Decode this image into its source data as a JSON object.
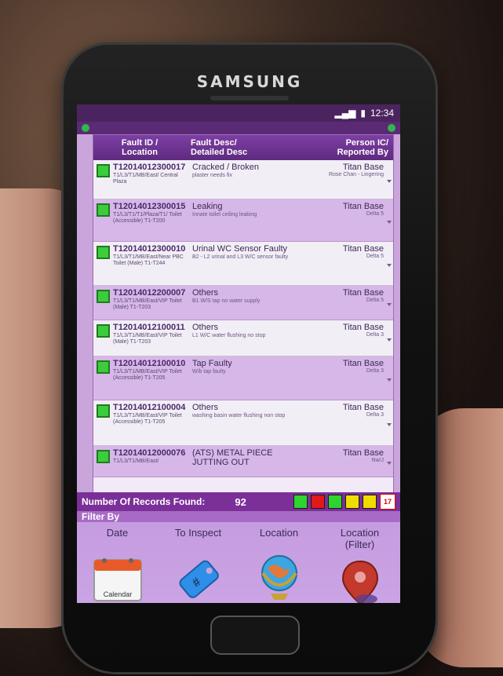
{
  "brand": "SAMSUNG",
  "status_time": "12:34",
  "table": {
    "headers": {
      "col1": [
        "Fault ID /",
        "Location"
      ],
      "col2": [
        "Fault Desc/",
        "Detailed Desc"
      ],
      "col3": [
        "Person IC/",
        "Reported By"
      ]
    },
    "rows": [
      {
        "id": "T12014012300017",
        "loc": "T1/L3/T1/MB/East/ Central Plaza",
        "desc": "Cracked / Broken",
        "detail": "plaster needs fix",
        "person": "Titan Base",
        "rep": "Rose Chan - Lingering"
      },
      {
        "id": "T12014012300015",
        "loc": "T1/L3/T1/T1/Plaza/T1/ Toilet (Accessible) T1-T200",
        "desc": "Leaking",
        "detail": "Innate toilet ceiling leaking",
        "person": "Titan Base",
        "rep": "Delta 5"
      },
      {
        "id": "T12014012300010",
        "loc": "T1/L3/T1/MB/East/Near PBC Toilet (Male) T1-T244",
        "desc": "Urinal WC Sensor Faulty",
        "detail": "B2 - L2 urinal and L3 W/C sensor faulty",
        "person": "Titan Base",
        "rep": "Delta 5"
      },
      {
        "id": "T12014012200007",
        "loc": "T1/L3/T1/MB/East/VIP Toilet (Male) T1-T203",
        "desc": "Others",
        "detail": "B1 W/S tap no water supply",
        "person": "Titan Base",
        "rep": "Delta 5"
      },
      {
        "id": "T12014012100011",
        "loc": "T1/L3/T1/MB/East/VIP Toilet (Male) T1-T203",
        "desc": "Others",
        "detail": "L1 W/C water flushing no stop",
        "person": "Titan Base",
        "rep": "Delta 3"
      },
      {
        "id": "T12014012100010",
        "loc": "T1/L3/T1/MB/East/VIP Toilet (Accessible) T1-T205",
        "desc": "Tap Faulty",
        "detail": "W/b tap faulty",
        "person": "Titan Base",
        "rep": "Delta 3"
      },
      {
        "id": "T12014012100004",
        "loc": "T1/L3/T1/MB/East/VIP Toilet (Accessible) T1-T205",
        "desc": "Others",
        "detail": "washing basin water flushing non stop",
        "person": "Titan Base",
        "rep": "Delta 3"
      },
      {
        "id": "T12014012000076",
        "loc": "T1/L3/T1/MB/East/",
        "desc": "(ATS) METAL PIECE JUTTING OUT",
        "detail": "",
        "person": "Titan Base",
        "rep": "Nw/J"
      }
    ]
  },
  "records": {
    "label": "Number Of Records Found:",
    "count": "92"
  },
  "legend_colors": [
    "#2fd42f",
    "#e01919",
    "#2fd42f",
    "#f0dd00",
    "#f0dd00"
  ],
  "calendar_mini": "17",
  "filter": {
    "title": "Filter By",
    "items": [
      {
        "label": "Date",
        "icon": "calendar-icon",
        "icon_text": "Calendar"
      },
      {
        "label": "To Inspect",
        "icon": "tag-icon",
        "icon_text": "#"
      },
      {
        "label": "Location",
        "icon": "globe-icon",
        "icon_text": ""
      },
      {
        "label": "Location\n(Filter)",
        "icon": "map-pin-icon",
        "icon_text": ""
      }
    ]
  }
}
